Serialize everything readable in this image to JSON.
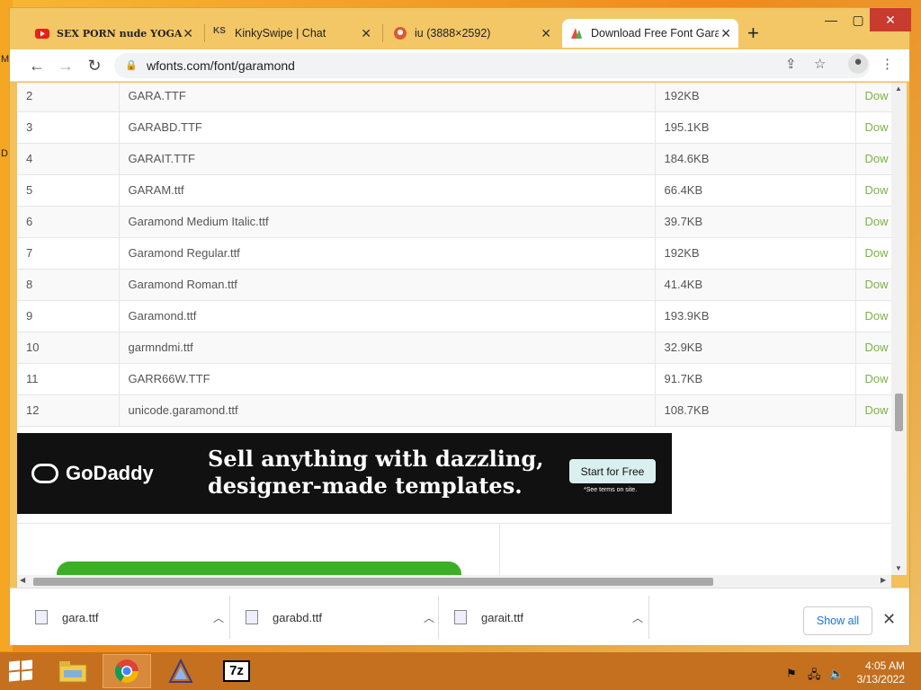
{
  "desktop": {
    "letters": [
      "M",
      "D"
    ]
  },
  "browser": {
    "tabs": [
      {
        "label": "SEX PORN nude YOGA",
        "icon": "youtube-icon",
        "active": false
      },
      {
        "label": "KinkySwipe | Chat",
        "icon": "ks-icon",
        "active": false
      },
      {
        "label": "iu (3888×2592)",
        "icon": "duckduckgo-icon",
        "active": false
      },
      {
        "label": "Download Free Font Gara",
        "icon": "wfonts-icon",
        "active": true
      }
    ],
    "new_tab": "+",
    "window_controls": {
      "minimize": "—",
      "maximize": "▢",
      "close": "✕"
    },
    "url": "wfonts.com/font/garamond"
  },
  "files": [
    {
      "num": "2",
      "name": "GARA.TTF",
      "size": "192KB",
      "action": "Dow"
    },
    {
      "num": "3",
      "name": "GARABD.TTF",
      "size": "195.1KB",
      "action": "Dow"
    },
    {
      "num": "4",
      "name": "GARAIT.TTF",
      "size": "184.6KB",
      "action": "Dow"
    },
    {
      "num": "5",
      "name": "GARAM.ttf",
      "size": "66.4KB",
      "action": "Dow"
    },
    {
      "num": "6",
      "name": "Garamond Medium Italic.ttf",
      "size": "39.7KB",
      "action": "Dow"
    },
    {
      "num": "7",
      "name": "Garamond Regular.ttf",
      "size": "192KB",
      "action": "Dow"
    },
    {
      "num": "8",
      "name": "Garamond Roman.ttf",
      "size": "41.4KB",
      "action": "Dow"
    },
    {
      "num": "9",
      "name": "Garamond.ttf",
      "size": "193.9KB",
      "action": "Dow"
    },
    {
      "num": "10",
      "name": "garmndmi.ttf",
      "size": "32.9KB",
      "action": "Dow"
    },
    {
      "num": "11",
      "name": "GARR66W.TTF",
      "size": "91.7KB",
      "action": "Dow"
    },
    {
      "num": "12",
      "name": "unicode.garamond.ttf",
      "size": "108.7KB",
      "action": "Dow"
    }
  ],
  "ad": {
    "brand": "GoDaddy",
    "headline_line1": "Sell anything with dazzling,",
    "headline_line2": "designer-made templates.",
    "cta": "Start for Free",
    "terms": "*See terms on site."
  },
  "downloads": [
    {
      "name": "gara.ttf"
    },
    {
      "name": "garabd.ttf"
    },
    {
      "name": "garait.ttf"
    }
  ],
  "shelf": {
    "show_all": "Show all",
    "close": "✕"
  },
  "taskbar": {
    "clock_time": "4:05 AM",
    "clock_date": "3/13/2022",
    "apps": [
      "file-explorer-icon",
      "chrome-icon",
      "app-a-icon",
      "7zip-icon"
    ],
    "seven_zip_label": "7z"
  },
  "colors": {
    "download_link": "#7cb342",
    "taskbar": "#c4701f",
    "accent_blue": "#1a73e8"
  }
}
